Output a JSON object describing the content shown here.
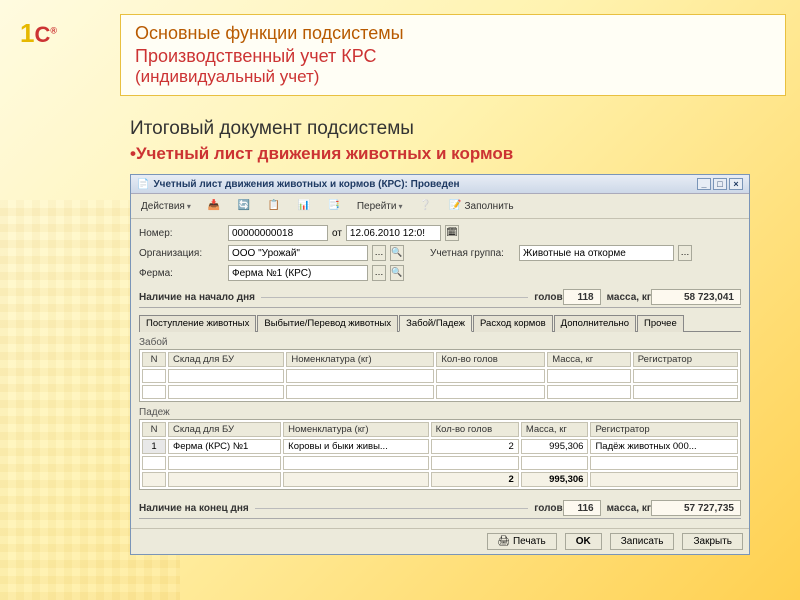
{
  "header": {
    "line1": "Основные функции подсистемы",
    "line2": "Производственный учет КРС",
    "line3": "(индивидуальный учет)"
  },
  "subtitle": {
    "line1": "Итоговый документ подсистемы",
    "line2": "•Учетный лист движения животных и кормов"
  },
  "window": {
    "title": "Учетный лист движения животных и кормов (КРС): Проведен",
    "toolbar": {
      "actions": "Действия",
      "navigate": "Перейти",
      "fill": "Заполнить"
    },
    "form": {
      "label_number": "Номер:",
      "number": "00000000018",
      "label_from": "от",
      "date": "12.06.2010 12:0!",
      "label_org": "Организация:",
      "org": "ООО \"Урожай\"",
      "label_group": "Учетная группа:",
      "group": "Животные на откорме",
      "label_farm": "Ферма:",
      "farm": "Ферма №1 (КРС)"
    },
    "start_day": {
      "label": "Наличие на начало дня",
      "heads_label": "голов",
      "heads": "118",
      "mass_label": "масса, кг",
      "mass": "58 723,041"
    },
    "tabs": [
      "Поступление животных",
      "Выбытие/Перевод животных",
      "Забой/Падеж",
      "Расход кормов",
      "Дополнительно",
      "Прочее"
    ],
    "active_tab": 2,
    "grid_headers": {
      "n": "N",
      "sklad": "Склад для БУ",
      "nomen": "Номенклатура (кг)",
      "heads": "Кол-во голов",
      "mass": "Масса, кг",
      "reg": "Регистратор"
    },
    "zaboi": {
      "title": "Забой"
    },
    "padez": {
      "title": "Падеж",
      "rows": [
        {
          "n": "1",
          "sklad": "Ферма (КРС) №1",
          "nomen": "Коровы и быки живы...",
          "heads": "2",
          "mass": "995,306",
          "reg": "Падёж животных 000..."
        }
      ],
      "total_heads": "2",
      "total_mass": "995,306"
    },
    "end_day": {
      "label": "Наличие на конец дня",
      "heads_label": "голов",
      "heads": "116",
      "mass_label": "масса, кг",
      "mass": "57 727,735"
    },
    "footer": {
      "print": "Печать",
      "ok": "OK",
      "write": "Записать",
      "close": "Закрыть"
    }
  }
}
